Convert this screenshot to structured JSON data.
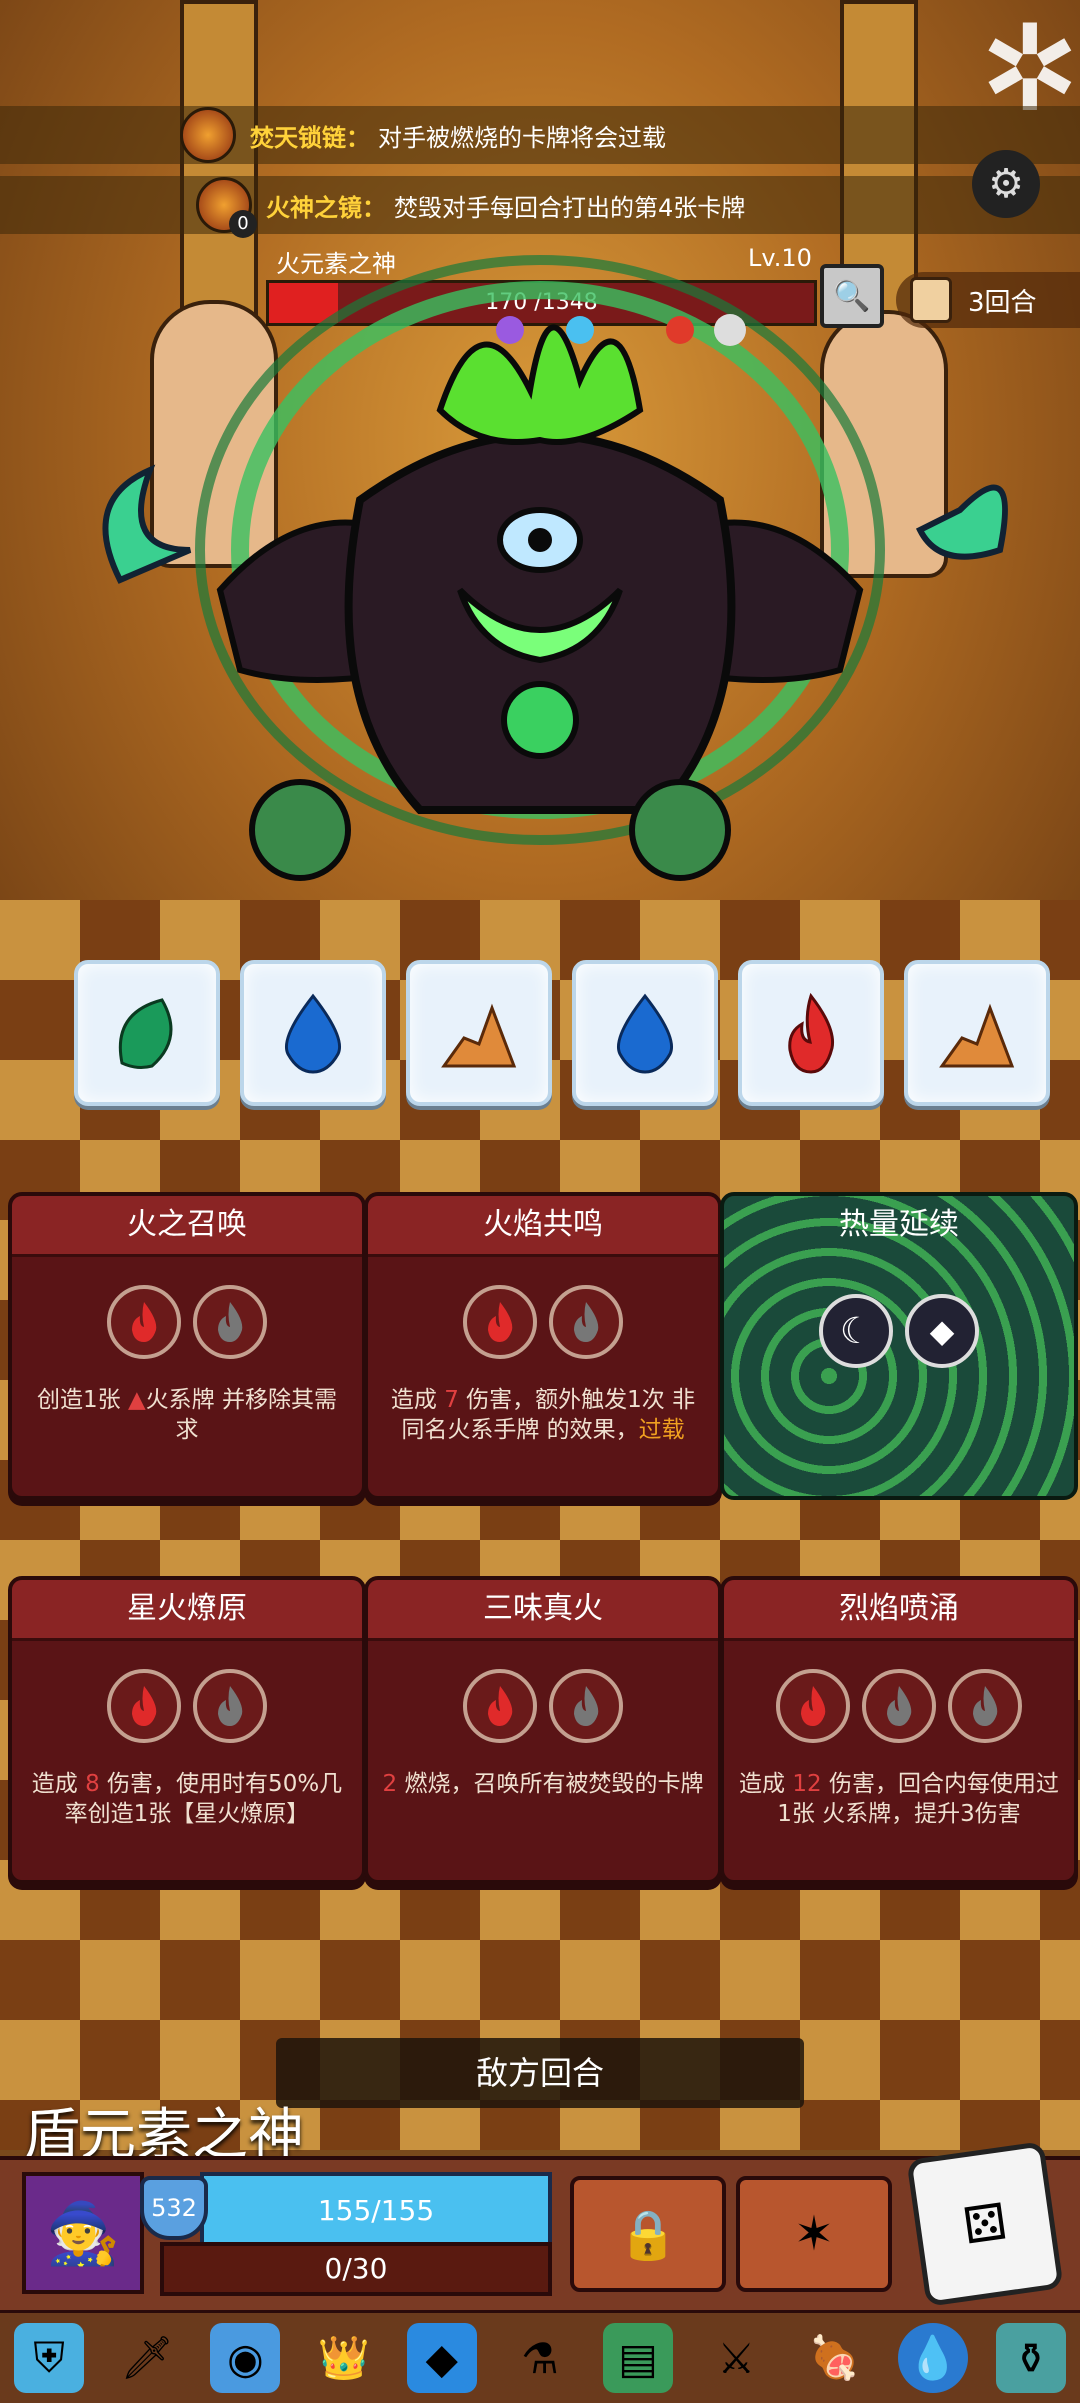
{
  "buffs": [
    {
      "title": "焚天锁链：",
      "desc": "对手被燃烧的卡牌将会过载"
    },
    {
      "title": "火神之镜：",
      "desc": "焚毁对手每回合打出的第4张卡牌",
      "count": "0"
    }
  ],
  "boss": {
    "name": "火元素之神",
    "level": "Lv.10",
    "hp_text": "170 /1348",
    "hp_fraction": 0.126
  },
  "round": {
    "label": "3回合"
  },
  "dice": [
    "leaf",
    "water",
    "earth",
    "water",
    "fire",
    "earth"
  ],
  "cards": [
    {
      "title": "火之召唤",
      "slots": [
        "fire",
        "gray-fire"
      ],
      "desc": [
        "创造1张 ",
        "火系牌",
        " 并移除其需求"
      ]
    },
    {
      "title": "火焰共鸣",
      "slots": [
        "fire",
        "gray-fire"
      ],
      "desc": [
        "造成 ",
        "7",
        " 伤害，额外触发1次 非同名",
        "火系手牌",
        " 的效果，",
        "过载"
      ]
    },
    {
      "title": "热量延续",
      "slots": [
        "moon",
        "diamond"
      ]
    },
    {
      "title": "星火燎原",
      "slots": [
        "fire",
        "gray-fire"
      ],
      "desc": [
        "造成 ",
        "8",
        " 伤害，使用时有50%几率创造1张【星火燎原】"
      ]
    },
    {
      "title": "三味真火",
      "slots": [
        "fire",
        "gray-fire"
      ],
      "desc": [
        "2",
        " 燃烧，召唤所有被焚毁的卡牌"
      ]
    },
    {
      "title": "烈焰喷涌",
      "slots": [
        "fire",
        "gray-fire",
        "gray-fire"
      ],
      "desc": [
        "造成 ",
        "12",
        " 伤害，回合内每使用过1张 ",
        "火系牌",
        "，提升3伤害"
      ]
    }
  ],
  "enemy_turn": "敌方回合",
  "opponent_name": "盾元素之神",
  "player": {
    "shield": "532",
    "hp_text": "155/155",
    "xp_text": "0/30"
  },
  "items": [
    "shield-ice-icon",
    "spear-icon",
    "gem-palette-icon",
    "crown-icon",
    "blue-cube-icon",
    "potion-icon",
    "green-book-icon",
    "sword-icon",
    "meat-icon",
    "water-drop-icon",
    "jar-icon"
  ],
  "colors": {
    "accent_red": "#e02020",
    "hp_blue": "#4ac0f0",
    "highlight_orange": "#f0a020"
  }
}
